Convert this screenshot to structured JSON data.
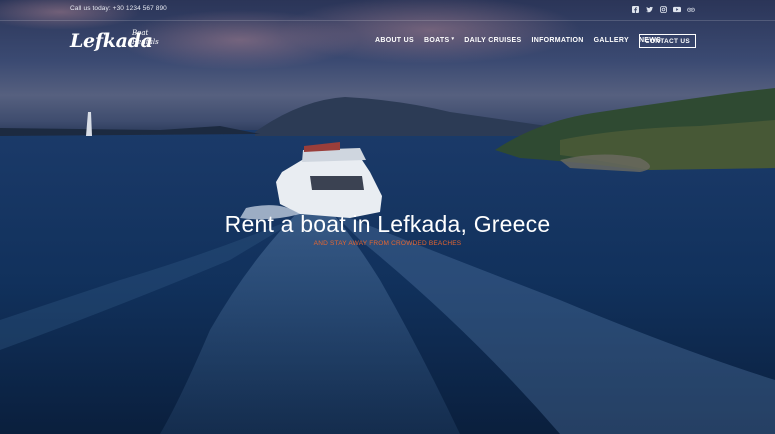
{
  "topbar": {
    "phone": "Call us today: +30 1234 567 890",
    "social_icons": [
      "facebook-icon",
      "twitter-icon",
      "instagram-icon",
      "youtube-icon",
      "tripadvisor-icon"
    ]
  },
  "brand": {
    "name": "Lefkada",
    "sub_line1": "Boat",
    "sub_line2": "Rentals"
  },
  "nav": {
    "items": [
      {
        "label": "ABOUT US"
      },
      {
        "label": "BOATS",
        "has_dropdown": true
      },
      {
        "label": "DAILY CRUISES"
      },
      {
        "label": "INFORMATION"
      },
      {
        "label": "GALLERY"
      },
      {
        "label": "NEWS"
      }
    ],
    "cta": "CONTACT US"
  },
  "hero": {
    "title": "Rent a boat in Lefkada, Greece",
    "subtitle": "AND STAY AWAY FROM CROWDED BEACHES",
    "subtitle_color": "#e8662f"
  }
}
